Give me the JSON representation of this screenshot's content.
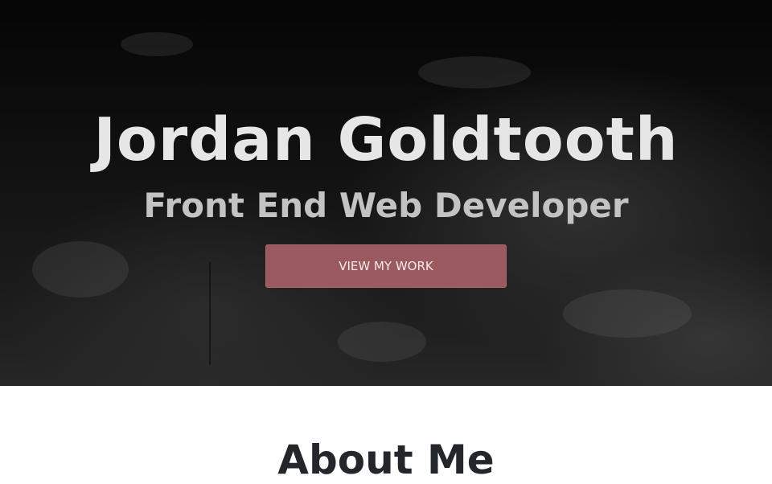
{
  "hero": {
    "title": "Jordan Goldtooth",
    "subtitle": "Front End Web Developer",
    "cta_label": "VIEW MY WORK"
  },
  "about": {
    "title": "About Me"
  },
  "colors": {
    "hero_background": "#111111",
    "title_text": "#e6e6e6",
    "subtitle_text": "#c3c3c3",
    "button_background": "#9a5a60",
    "button_text": "#f4eaea",
    "about_title_text": "#23262b"
  }
}
